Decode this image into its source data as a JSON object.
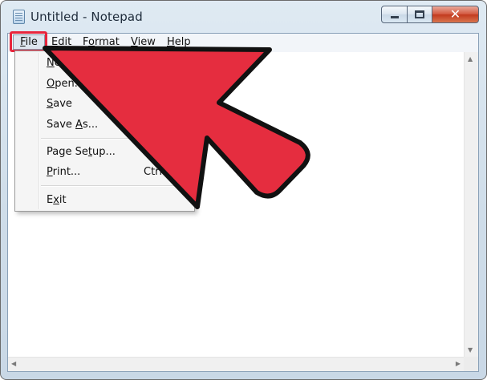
{
  "window": {
    "title": "Untitled - Notepad",
    "close_glyph": "✕"
  },
  "menubar": {
    "items": [
      "File",
      "Edit",
      "Format",
      "View",
      "Help"
    ]
  },
  "file_menu": {
    "items": [
      "New",
      "Open...",
      "Save",
      "Save As...",
      "Page Setup...",
      "Print...",
      "Exit"
    ],
    "print_shortcut": "Ctrl+P"
  },
  "icons": {
    "app": "notepad-icon",
    "minimize": "minimize-icon",
    "maximize": "maximize-icon",
    "close": "close-icon",
    "pointer": "red-arrow-pointer"
  },
  "colors": {
    "highlight": "#e8253c",
    "arrow_fill": "#e52d3f",
    "arrow_outline": "#111111"
  }
}
